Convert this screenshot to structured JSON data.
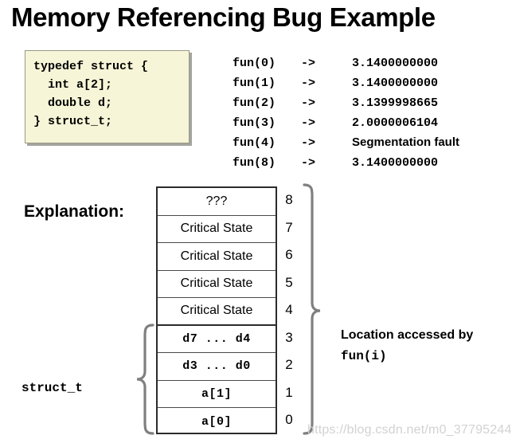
{
  "slide": {
    "title": "Memory Referencing Bug Example"
  },
  "code_block": {
    "language": "c",
    "background_color": "#F6F5D7",
    "border_color": "#9a9a86",
    "text": "typedef struct {\n  int a[2];\n  double d;\n} struct_t;"
  },
  "fun_output": {
    "rows": [
      {
        "call": "fun(0)",
        "arrow": "->",
        "result": "3.1400000000",
        "result_style": "mono"
      },
      {
        "call": "fun(1)",
        "arrow": "->",
        "result": "3.1400000000",
        "result_style": "mono"
      },
      {
        "call": "fun(2)",
        "arrow": "->",
        "result": "3.1399998665",
        "result_style": "mono"
      },
      {
        "call": "fun(3)",
        "arrow": "->",
        "result": "2.0000006104",
        "result_style": "mono"
      },
      {
        "call": "fun(4)",
        "arrow": "->",
        "result": "Segmentation fault",
        "result_style": "prose"
      },
      {
        "call": "fun(8)",
        "arrow": "->",
        "result": "3.1400000000",
        "result_style": "mono"
      }
    ]
  },
  "explanation": {
    "label": "Explanation:",
    "struct_label": "struct_t"
  },
  "memory_table": {
    "rows": [
      {
        "content": "???",
        "index": "8",
        "style": "prose"
      },
      {
        "content": "Critical State",
        "index": "7",
        "style": "prose"
      },
      {
        "content": "Critical State",
        "index": "6",
        "style": "prose"
      },
      {
        "content": "Critical State",
        "index": "5",
        "style": "prose"
      },
      {
        "content": "Critical State",
        "index": "4",
        "style": "prose"
      },
      {
        "content": "d7 ... d4",
        "index": "3",
        "style": "mono"
      },
      {
        "content": "d3 ... d0",
        "index": "2",
        "style": "mono"
      },
      {
        "content": "a[1]",
        "index": "1",
        "style": "mono"
      },
      {
        "content": "a[0]",
        "index": "0",
        "style": "mono"
      }
    ]
  },
  "access_note": {
    "line1": "Location accessed by",
    "line2": "fun(i)"
  },
  "watermark": {
    "text": "https://blog.csdn.net/m0_37795244",
    "color": "#d2d2d2"
  }
}
